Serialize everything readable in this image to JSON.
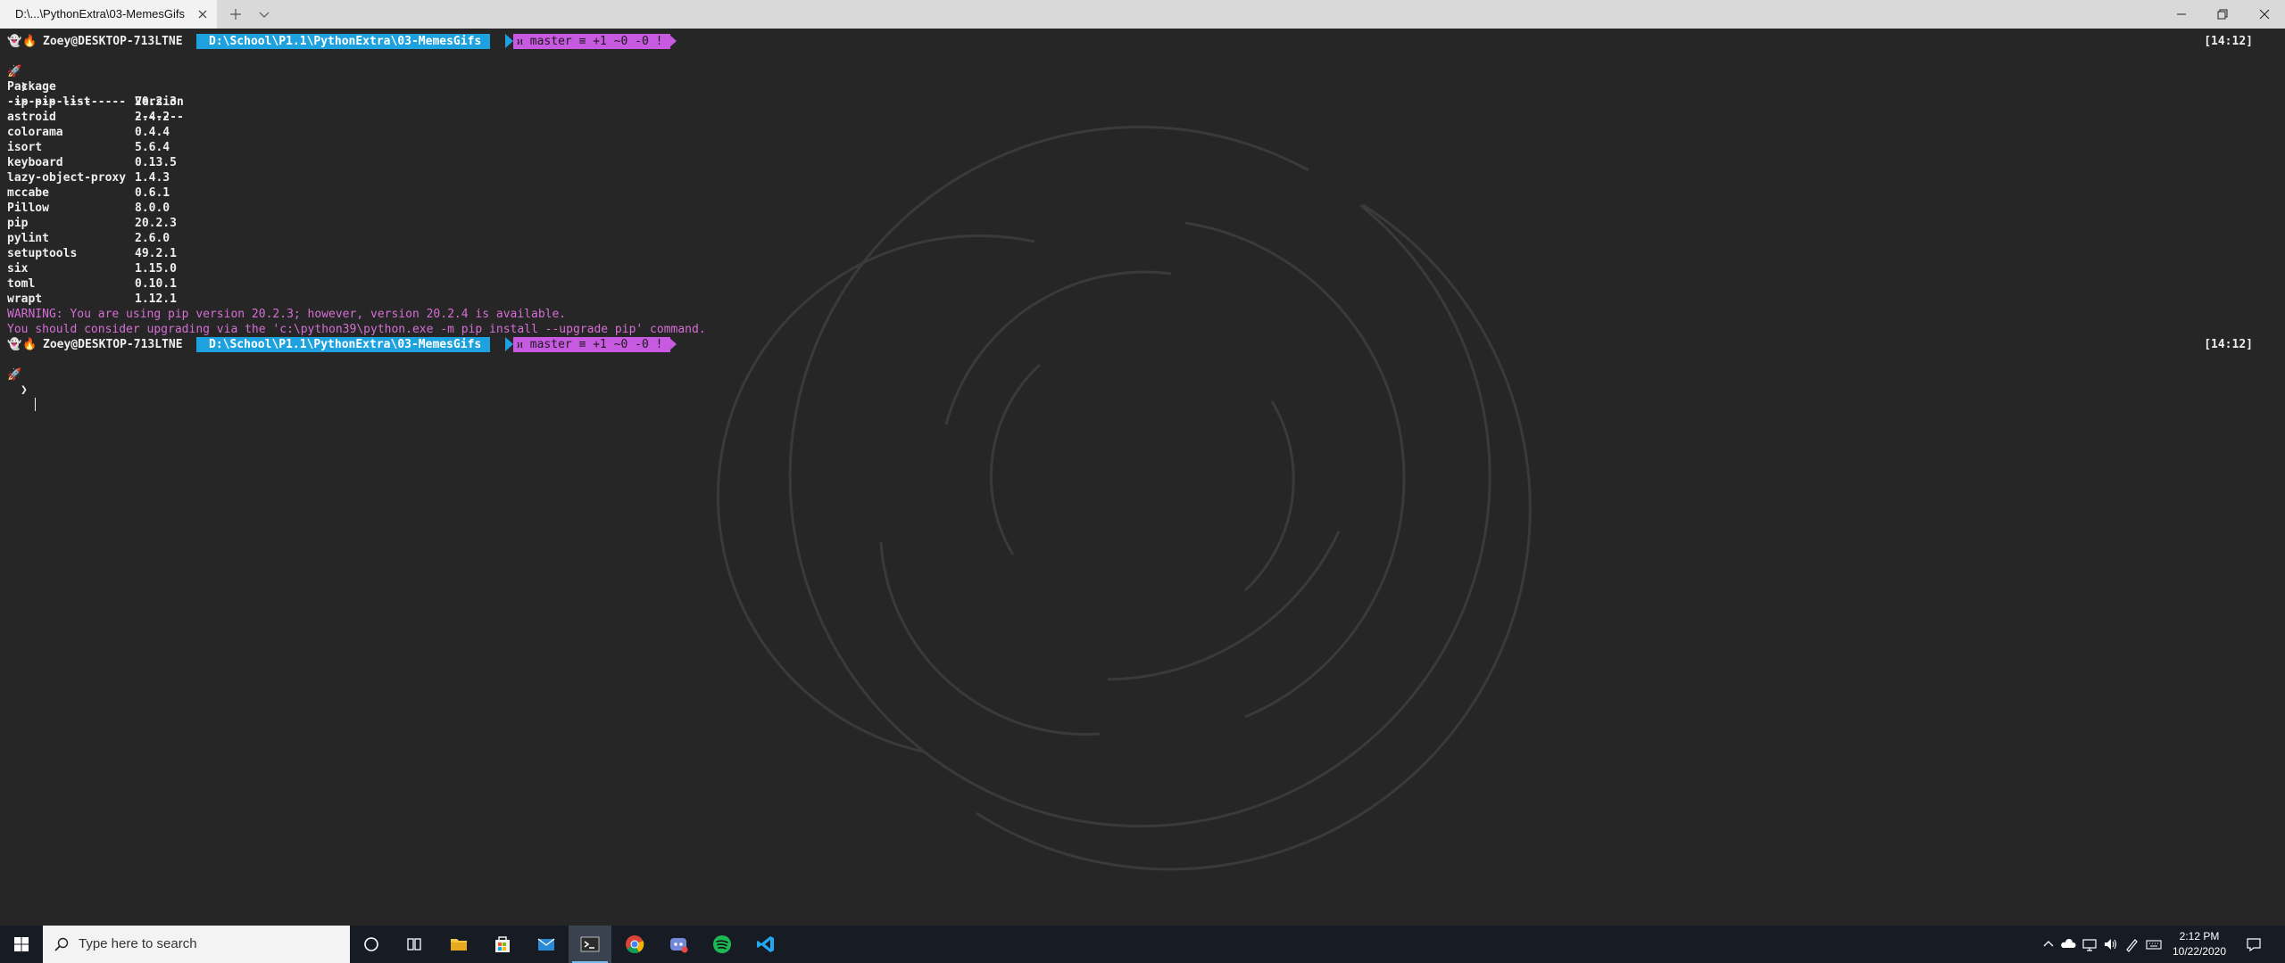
{
  "window": {
    "tab_title": "D:\\...\\PythonExtra\\03-MemesGifs"
  },
  "prompt": {
    "user_host": "Zoey@DESKTOP-713LTNE",
    "path": "D:\\School\\P1.1\\PythonExtra\\03-MemesGifs",
    "git": "ᴎ master ≡ +1 ~0 -0 !",
    "time": "[14:12]",
    "symbol": "❯"
  },
  "command": "pip list",
  "table": {
    "headers": [
      "Package",
      "Version"
    ],
    "separator": [
      "-----------------",
      "-------"
    ],
    "rows": [
      [
        "-ip",
        "20.2.3"
      ],
      [
        "astroid",
        "2.4.2"
      ],
      [
        "colorama",
        "0.4.4"
      ],
      [
        "isort",
        "5.6.4"
      ],
      [
        "keyboard",
        "0.13.5"
      ],
      [
        "lazy-object-proxy",
        "1.4.3"
      ],
      [
        "mccabe",
        "0.6.1"
      ],
      [
        "Pillow",
        "8.0.0"
      ],
      [
        "pip",
        "20.2.3"
      ],
      [
        "pylint",
        "2.6.0"
      ],
      [
        "setuptools",
        "49.2.1"
      ],
      [
        "six",
        "1.15.0"
      ],
      [
        "toml",
        "0.10.1"
      ],
      [
        "wrapt",
        "1.12.1"
      ]
    ]
  },
  "warnings": [
    "WARNING: You are using pip version 20.2.3; however, version 20.2.4 is available.",
    "You should consider upgrading via the 'c:\\python39\\python.exe -m pip install --upgrade pip' command."
  ],
  "taskbar": {
    "search_placeholder": "Type here to search",
    "apps": [
      "cortana-icon",
      "task-view-icon",
      "file-explorer-icon",
      "store-icon",
      "mail-icon",
      "terminal-icon",
      "chrome-icon",
      "discord-icon",
      "spotify-icon",
      "vscode-icon"
    ],
    "active_app": "terminal-icon",
    "time": "2:12 PM",
    "date": "10/22/2020"
  },
  "colors": {
    "terminal_bg": "#262626",
    "path_segment": "#1da1df",
    "git_segment": "#c75ae0",
    "warning_text": "#d66ed6",
    "taskbar_bg": "#171c24"
  }
}
